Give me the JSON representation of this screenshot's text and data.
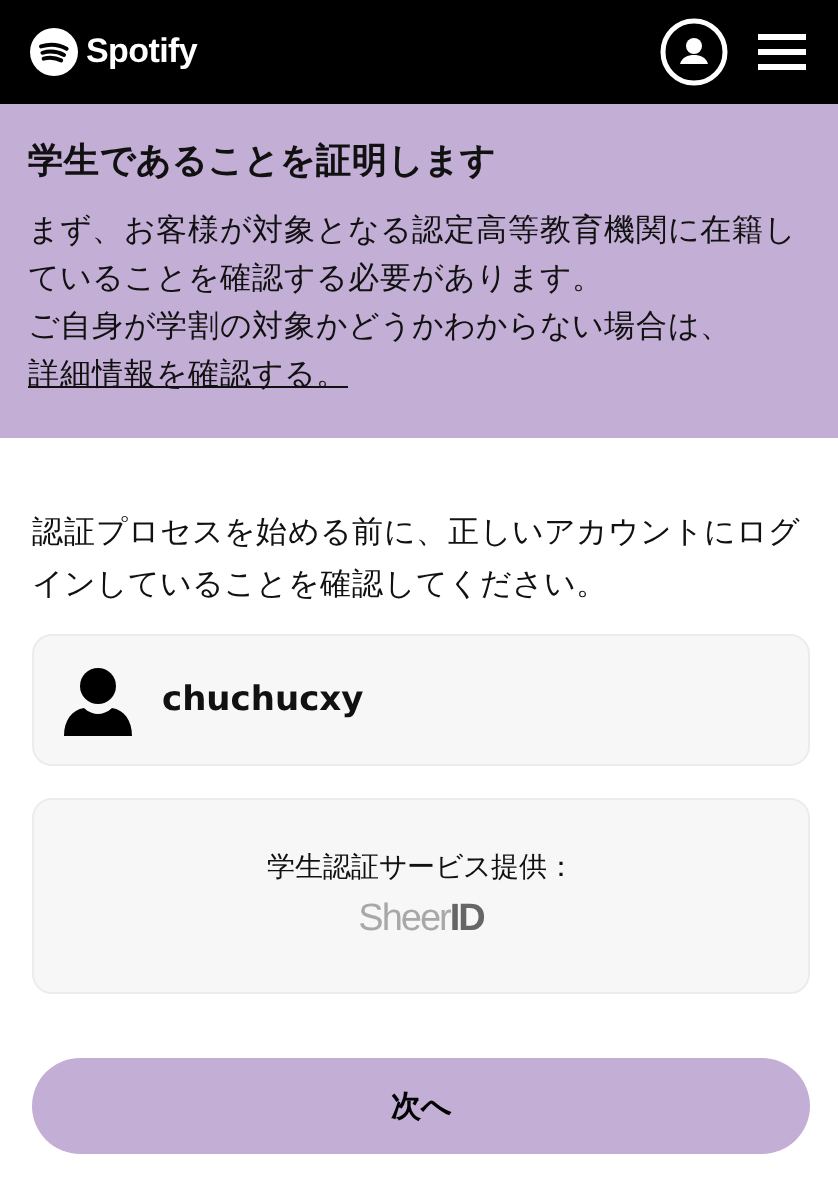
{
  "header": {
    "logo": "Spotify"
  },
  "hero": {
    "title": "学生であることを証明します",
    "text": "まず、お客様が対象となる認定高等教育機関に在籍していることを確認する必要があります。",
    "note": "ご自身が学割の対象かどうかわからない場合は、",
    "link": "詳細情報を確認する。"
  },
  "intro": "認証プロセスを始める前に、正しいアカウントにログインしていることを確認してください。",
  "account": {
    "username": "chuchucxy"
  },
  "provider": {
    "label": "学生認証サービス提供：",
    "logo": "Sheer",
    "logo_mark": "ID"
  },
  "next_button": "次へ"
}
